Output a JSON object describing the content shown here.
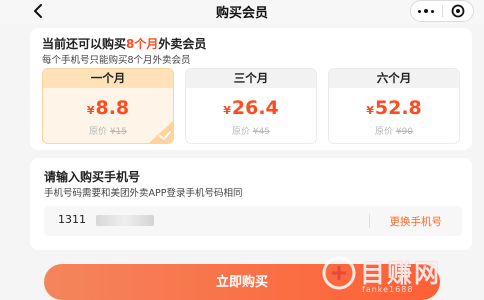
{
  "nav": {
    "title": "购买会员",
    "back_icon": "chevron-left-icon",
    "more_icon": "more-dots-icon",
    "close_icon": "target-close-icon"
  },
  "purchase": {
    "title_prefix": "当前还可以购买",
    "title_highlight": "8个月",
    "title_suffix": "外卖会员",
    "subtitle": "每个手机号只能购买8个月外卖会员",
    "plans": [
      {
        "name": "一个月",
        "currency": "¥",
        "price": "8.8",
        "original_label": "原价",
        "original_price": "¥15",
        "selected": true
      },
      {
        "name": "三个月",
        "currency": "¥",
        "price": "26.4",
        "original_label": "原价",
        "original_price": "¥45",
        "selected": false
      },
      {
        "name": "六个月",
        "currency": "¥",
        "price": "52.8",
        "original_label": "原价",
        "original_price": "¥90",
        "selected": false
      }
    ]
  },
  "phone": {
    "title": "请输入购买手机号",
    "subtitle": "手机号码需要和美团外卖APP登录手机号码相同",
    "value": "1311",
    "change_label": "更换手机号"
  },
  "buy_button": {
    "label": "立即购买"
  },
  "watermark": {
    "text": "目赚网",
    "url": "fanke1688"
  },
  "colors": {
    "accent": "#ff4b1f",
    "selected_bg": "#fff4e8",
    "selected_head": "#ffe2b8",
    "button_gradient_start": "#f4855c",
    "button_gradient_end": "#ff5f35"
  }
}
